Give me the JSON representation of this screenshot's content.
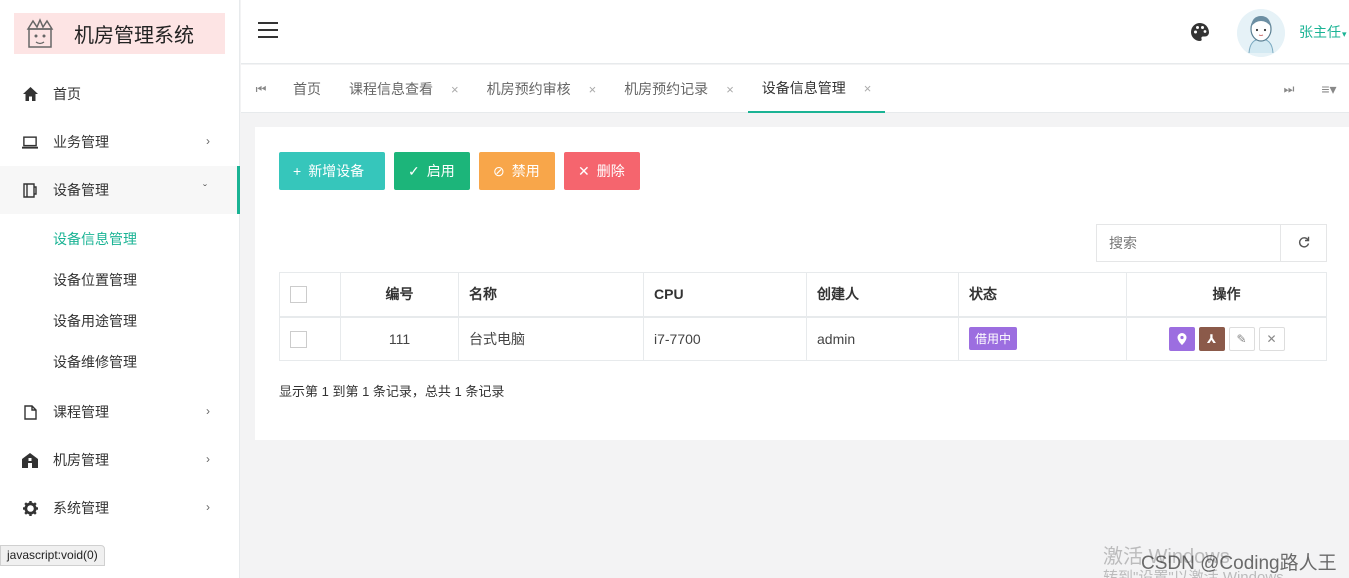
{
  "app": {
    "title": "机房管理系统"
  },
  "sidebar": {
    "items": [
      {
        "label": "首页",
        "icon": "home-icon"
      },
      {
        "label": "业务管理",
        "icon": "laptop-icon"
      },
      {
        "label": "设备管理",
        "icon": "device-icon"
      },
      {
        "label": "课程管理",
        "icon": "file-icon"
      },
      {
        "label": "机房管理",
        "icon": "building-icon"
      },
      {
        "label": "系统管理",
        "icon": "gear-icon"
      }
    ],
    "submenu": [
      {
        "label": "设备信息管理",
        "active": true
      },
      {
        "label": "设备位置管理"
      },
      {
        "label": "设备用途管理"
      },
      {
        "label": "设备维修管理"
      }
    ]
  },
  "statusbar": {
    "text": "javascript:void(0)"
  },
  "header": {
    "username": "张主任"
  },
  "tabs": [
    {
      "label": "首页",
      "closable": false
    },
    {
      "label": "课程信息查看",
      "closable": true
    },
    {
      "label": "机房预约审核",
      "closable": true
    },
    {
      "label": "机房预约记录",
      "closable": true
    },
    {
      "label": "设备信息管理",
      "closable": true,
      "active": true
    }
  ],
  "toolbar": {
    "add_label": "新增设备",
    "enable_label": "启用",
    "disable_label": "禁用",
    "delete_label": "删除"
  },
  "search": {
    "placeholder": "搜索"
  },
  "table": {
    "headers": [
      "编号",
      "名称",
      "CPU",
      "创建人",
      "状态",
      "操作"
    ],
    "rows": [
      {
        "id": "111",
        "name": "台式电脑",
        "cpu": "i7-7700",
        "creator": "admin",
        "status": "借用中"
      }
    ]
  },
  "pagination": {
    "info": "显示第 1 到第 1 条记录，总共 1 条记录"
  },
  "overlay": {
    "watermark_line1": "激活 Windows",
    "watermark_line2": "转到\"设置\"以激活 Windows",
    "csdn": "CSDN @Coding路人王"
  },
  "colors": {
    "accent": "#1ab394",
    "add": "#36c6bb",
    "enable": "#1cb57a",
    "disable": "#f8a64a",
    "delete": "#f5656e",
    "badge": "#9c6ee0"
  }
}
